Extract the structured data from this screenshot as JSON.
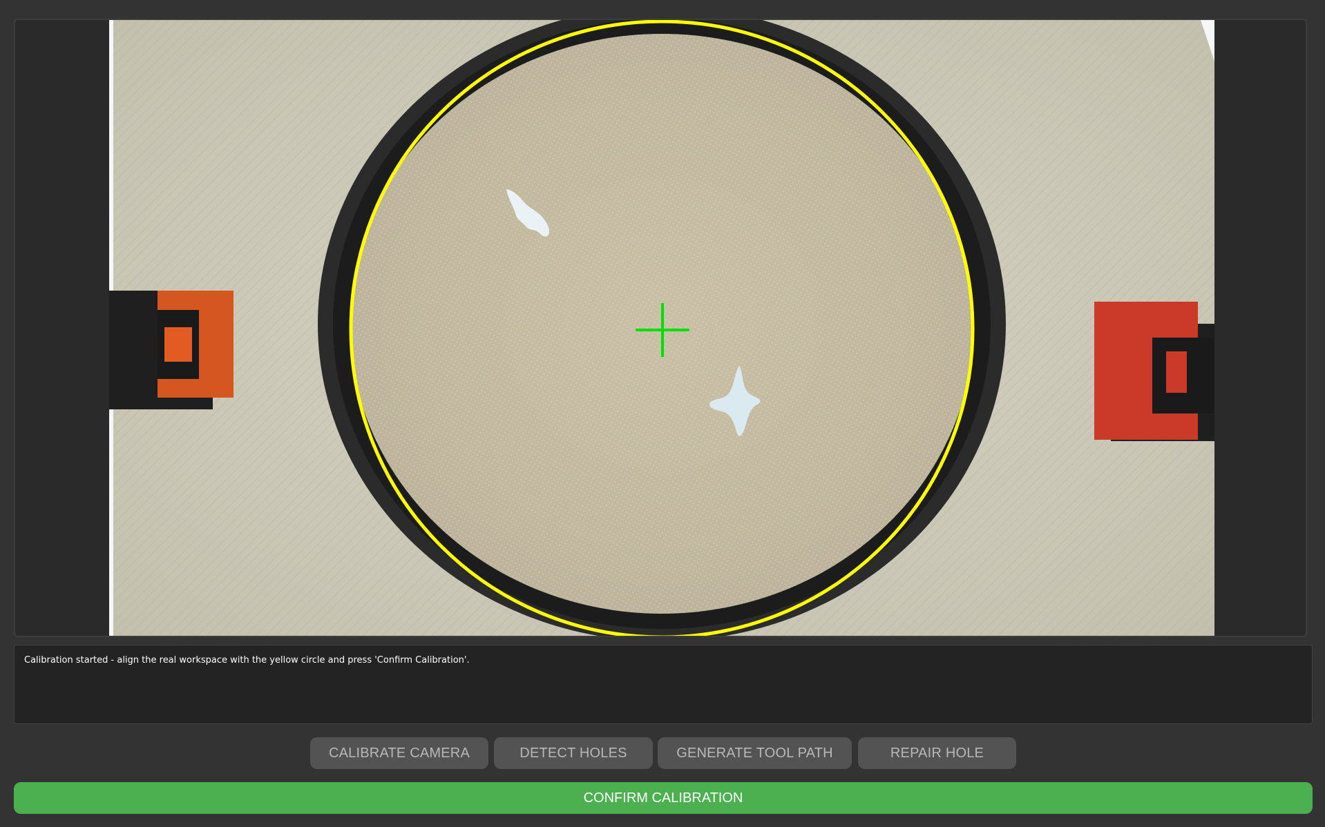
{
  "status": {
    "message": "Calibration started - align the real workspace with the yellow circle and press 'Confirm Calibration'."
  },
  "buttons": {
    "calibrate_camera": "CALIBRATE CAMERA",
    "detect_holes": "DETECT HOLES",
    "generate_tool_path": "GENERATE TOOL PATH",
    "repair_hole": "REPAIR HOLE"
  },
  "confirm": {
    "label": "CONFIRM CALIBRATION"
  },
  "colors": {
    "background": "#333333",
    "confirm_green": "#4caf50",
    "calibration_circle": "#ffff00",
    "crosshair": "#00e000"
  }
}
